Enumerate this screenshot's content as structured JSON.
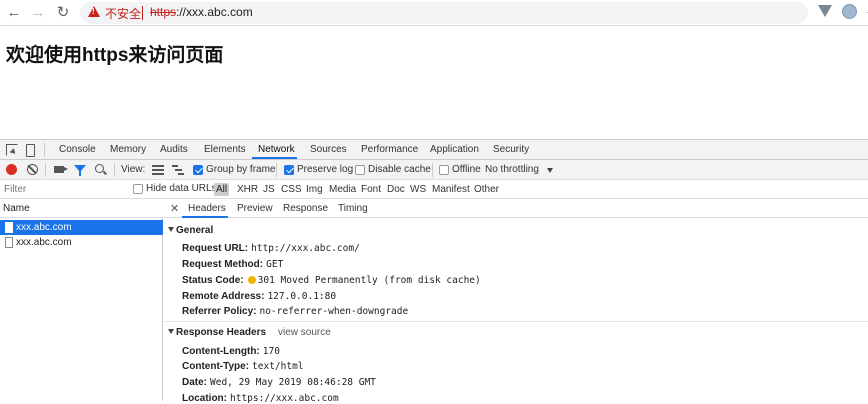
{
  "browser": {
    "insecure_label": "不安全",
    "url_scheme": "https",
    "url_rest": "://xxx.abc.com"
  },
  "page": {
    "heading": "欢迎使用https来访问页面"
  },
  "devtools": {
    "tabs": [
      "Console",
      "Memory",
      "Audits",
      "Elements",
      "Network",
      "Sources",
      "Performance",
      "Application",
      "Security"
    ],
    "active_tab": "Network",
    "toolbar": {
      "view_label": "View:",
      "group_by_frame": "Group by frame",
      "preserve_log": "Preserve log",
      "disable_cache": "Disable cache",
      "offline": "Offline",
      "throttling": "No throttling"
    },
    "filter": {
      "placeholder": "Filter",
      "hide_data_urls": "Hide data URLs",
      "types": [
        "All",
        "XHR",
        "JS",
        "CSS",
        "Img",
        "Media",
        "Font",
        "Doc",
        "WS",
        "Manifest",
        "Other"
      ]
    },
    "requests": {
      "name_header": "Name",
      "rows": [
        "xxx.abc.com",
        "xxx.abc.com"
      ]
    },
    "detail_tabs": [
      "Headers",
      "Preview",
      "Response",
      "Timing"
    ],
    "general": {
      "title": "General",
      "request_url_key": "Request URL:",
      "request_url": "http://xxx.abc.com/",
      "request_method_key": "Request Method:",
      "request_method": "GET",
      "status_code_key": "Status Code:",
      "status_code": "301 Moved Permanently (from disk cache)",
      "remote_address_key": "Remote Address:",
      "remote_address": "127.0.0.1:80",
      "referrer_policy_key": "Referrer Policy:",
      "referrer_policy": "no-referrer-when-downgrade"
    },
    "response_headers": {
      "title": "Response Headers",
      "view_source": "view source",
      "content_length_key": "Content-Length:",
      "content_length": "170",
      "content_type_key": "Content-Type:",
      "content_type": "text/html",
      "date_key": "Date:",
      "date": "Wed, 29 May 2019 08:46:28 GMT",
      "location_key": "Location:",
      "location": "https://xxx.abc.com"
    }
  },
  "colors": {
    "accent": "#1a73e8",
    "insecure": "#c5221f",
    "status_warning": "#f2b200"
  }
}
